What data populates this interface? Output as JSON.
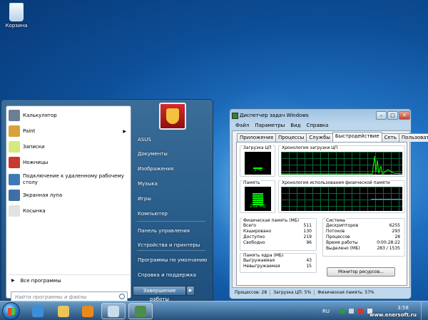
{
  "desktop": {
    "recycle_bin": "Корзина"
  },
  "start_menu": {
    "programs": [
      {
        "label": "Калькулятор",
        "icon": "calculator-icon",
        "color": "#6a7f95"
      },
      {
        "label": "Paint",
        "icon": "paint-icon",
        "color": "#d8a23a",
        "submenu": true
      },
      {
        "label": "Записки",
        "icon": "sticky-notes-icon",
        "color": "#d7e97a"
      },
      {
        "label": "Ножницы",
        "icon": "snipping-tool-icon",
        "color": "#c83a2e"
      },
      {
        "label": "Подключение к удаленному рабочему столу",
        "icon": "remote-desktop-icon",
        "color": "#3f78b7"
      },
      {
        "label": "Экранная лупа",
        "icon": "magnifier-icon",
        "color": "#3e6fa5"
      },
      {
        "label": "Косынка",
        "icon": "solitaire-icon",
        "color": "#e2e2e2"
      }
    ],
    "all_programs": "Все программы",
    "search_placeholder": "Найти программы и файлы",
    "right_links": [
      "ASUS",
      "Документы",
      "Изображения",
      "Музыка",
      "Игры",
      "Компьютер",
      "Панель управления",
      "Устройства и принтеры",
      "Программы по умолчанию",
      "Справка и поддержка"
    ],
    "shutdown": "Завершение работы"
  },
  "task_manager": {
    "title": "Диспетчер задач Windows",
    "menu": [
      "Файл",
      "Параметры",
      "Вид",
      "Справка"
    ],
    "tabs": [
      "Приложения",
      "Процессы",
      "Службы",
      "Быстродействие",
      "Сеть",
      "Пользователи"
    ],
    "active_tab": 3,
    "cpu_usage_label": "Загрузка ЦП",
    "cpu_history_label": "Хронология загрузки ЦП",
    "cpu_percent": "5 %",
    "memory_label": "Память",
    "memory_history_label": "Хронология использования физической памяти",
    "memory_value": "292 МБ",
    "physical_memory": {
      "title": "Физическая память (МБ)",
      "rows": [
        {
          "label": "Всего",
          "value": "511"
        },
        {
          "label": "Кэшировано",
          "value": "130"
        },
        {
          "label": "Доступно",
          "value": "219"
        },
        {
          "label": "Свободно",
          "value": "96"
        }
      ]
    },
    "kernel_memory": {
      "title": "Память ядра (МБ)",
      "rows": [
        {
          "label": "Выгружаемая",
          "value": "43"
        },
        {
          "label": "Невыгружаемая",
          "value": "15"
        }
      ]
    },
    "system": {
      "title": "Система",
      "rows": [
        {
          "label": "Дескрипторов",
          "value": "6255"
        },
        {
          "label": "Потоков",
          "value": "293"
        },
        {
          "label": "Процессов",
          "value": "28"
        },
        {
          "label": "Время работы",
          "value": "0:00:28:22"
        },
        {
          "label": "Выделено (МБ)",
          "value": "283 / 1535"
        }
      ]
    },
    "resource_monitor_button": "Монитор ресурсов...",
    "status": {
      "processes": "Процессов: 28",
      "cpu": "Загрузка ЦП: 5%",
      "memory": "Физическая память: 57%"
    },
    "accent_green": "#00ff00"
  },
  "taskbar": {
    "language": "RU",
    "time": "3:58",
    "watermark": "www.enersoft.ru",
    "buttons": [
      {
        "name": "taskbar-ie-button",
        "icon": "internet-explorer-icon",
        "color": "#3b8fd8"
      },
      {
        "name": "taskbar-explorer-button",
        "icon": "folder-icon",
        "color": "#e9c55a"
      },
      {
        "name": "taskbar-media-button",
        "icon": "media-player-icon",
        "color": "#e88a1a"
      },
      {
        "name": "taskbar-paint-button",
        "icon": "paint-icon",
        "color": "#c7ddee"
      },
      {
        "name": "taskbar-taskmgr-button",
        "icon": "task-manager-icon",
        "color": "#4d8c4d"
      }
    ]
  }
}
